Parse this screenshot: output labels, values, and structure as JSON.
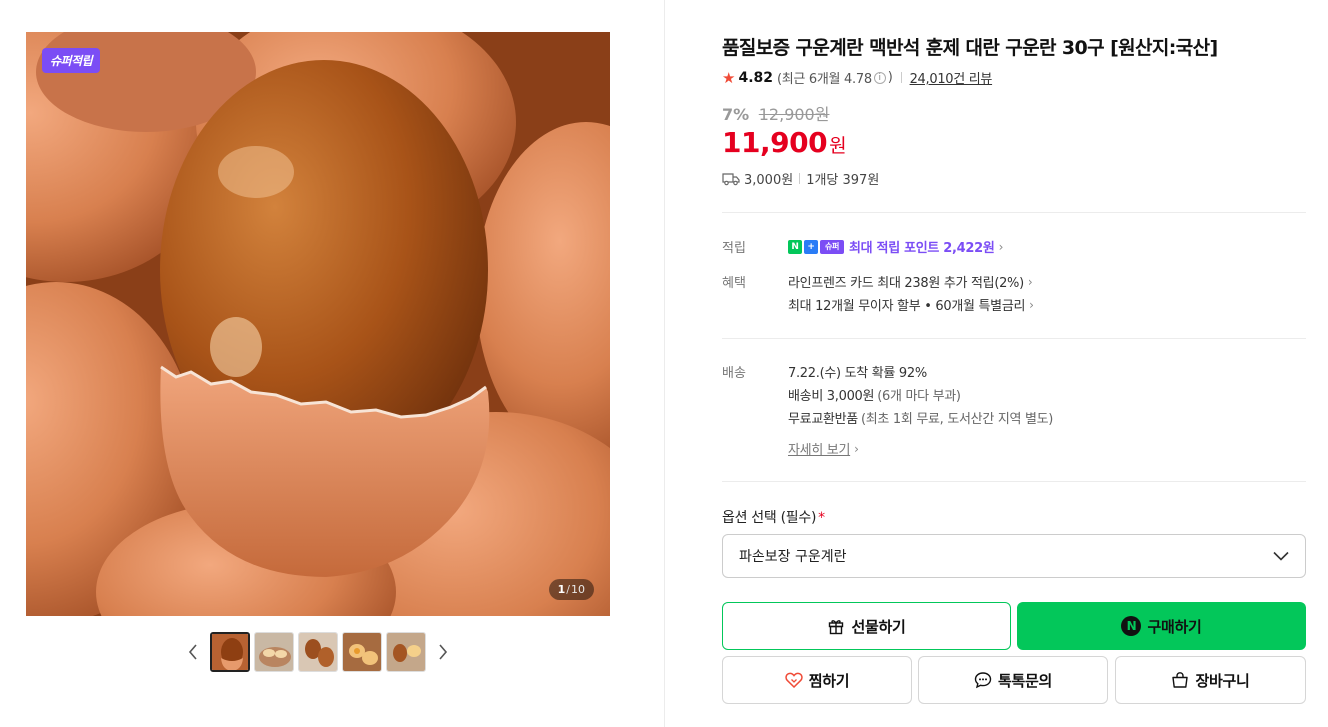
{
  "gallery": {
    "badge": "슈퍼적립",
    "counter_current": "1",
    "counter_separator": "/",
    "counter_total": "10"
  },
  "product": {
    "title": "품질보증 구운계란 맥반석 훈제 대란 구운란 30구 [원산지:국산]",
    "rating": "4.82",
    "rating_recent": "(최근 6개월 4.78",
    "rating_recent_close": ")",
    "reviews": "24,010건 리뷰",
    "discount": "7%",
    "original_price": "12,900원",
    "price": "11,900",
    "price_unit": "원",
    "shipping_fee": "3,000원",
    "unit_price": "1개당 397원"
  },
  "benefits": {
    "points_label": "적립",
    "badge_n": "N",
    "badge_plus": "+",
    "badge_super": "슈퍼",
    "points_text": "최대 적립 포인트 2,422원",
    "benefit_label": "혜택",
    "card_benefit": "라인프렌즈 카드 최대 238원 추가 적립(2%)",
    "installment": "최대 12개월 무이자 할부 • 60개월 특별금리"
  },
  "delivery": {
    "label": "배송",
    "arrival": "7.22.(수) 도착 확률 92%",
    "fee": "배송비 3,000원",
    "fee_note": "(6개 마다 부과)",
    "exchange": "무료교환반품",
    "exchange_note": "(최초 1회 무료, 도서산간 지역 별도)",
    "detail_link": "자세히 보기"
  },
  "option": {
    "label": "옵션 선택 (필수)",
    "required_mark": "*",
    "selected": "파손보장 구운계란"
  },
  "buttons": {
    "gift": "선물하기",
    "buy": "구매하기",
    "wish": "찜하기",
    "talk": "톡톡문의",
    "cart": "장바구니"
  },
  "colors": {
    "accent_green": "#03c75a",
    "price_red": "#e5001f",
    "super_purple": "#7b4df5",
    "star": "#f04b37"
  }
}
